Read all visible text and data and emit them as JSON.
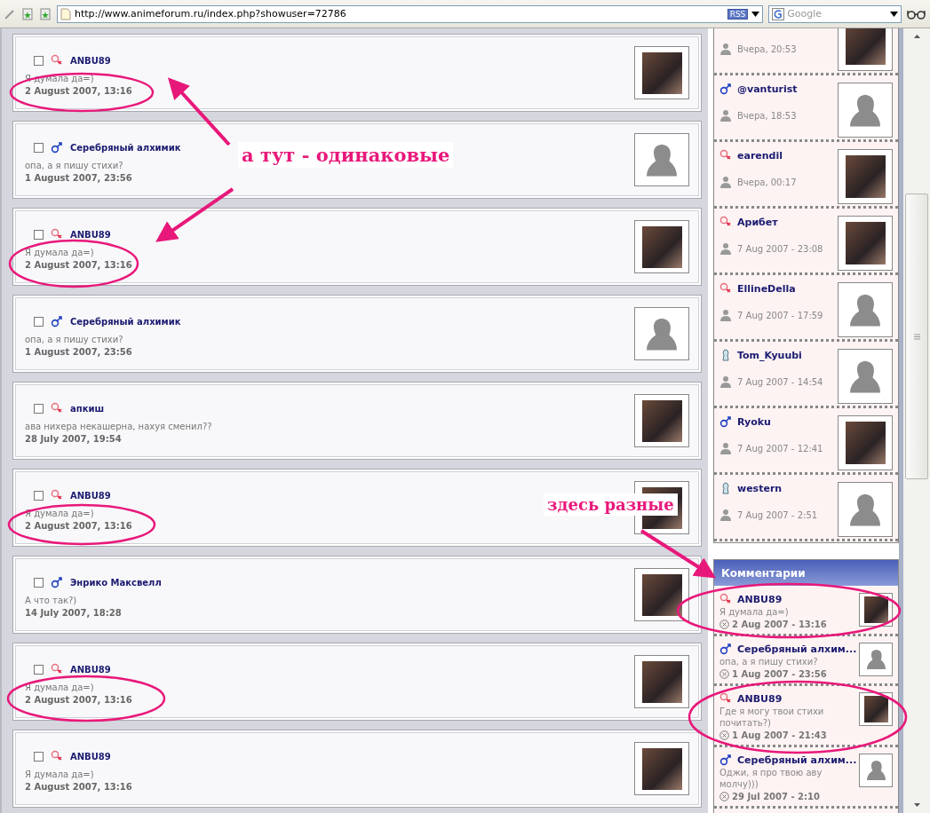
{
  "browser": {
    "url": "http://www.animeforum.ru/index.php?showuser=72786",
    "rss_badge": "RSS",
    "search": {
      "placeholder": "Google"
    }
  },
  "posts": [
    {
      "author": "ANBU89",
      "gender": {
        "kind": "female"
      },
      "text": "Я думала да=)",
      "date": "2 August 2007, 13:16",
      "avatar": {
        "kind": "photo"
      },
      "checked": false
    },
    {
      "author": "Серебряный алхимик",
      "gender": {
        "kind": "male"
      },
      "text": "опа, а я пишу стихи?",
      "date": "1 August 2007, 23:56",
      "avatar": {
        "kind": "default"
      },
      "checked": false
    },
    {
      "author": "ANBU89",
      "gender": {
        "kind": "female"
      },
      "text": "Я думала да=)",
      "date": "2 August 2007, 13:16",
      "avatar": {
        "kind": "photo"
      },
      "checked": false
    },
    {
      "author": "Серебряный алхимик",
      "gender": {
        "kind": "male"
      },
      "text": "опа, а я пишу стихи?",
      "date": "1 August 2007, 23:56",
      "avatar": {
        "kind": "default"
      },
      "checked": false
    },
    {
      "author": "апкиш",
      "gender": {
        "kind": "female"
      },
      "text": "ава нихера некашерна, нахуя сменил??",
      "date": "28 July 2007, 19:54",
      "avatar": {
        "kind": "photo"
      },
      "checked": false
    },
    {
      "author": "ANBU89",
      "gender": {
        "kind": "female"
      },
      "text": "Я думала да=)",
      "date": "2 August 2007, 13:16",
      "avatar": {
        "kind": "photo"
      },
      "checked": false
    },
    {
      "author": "Энрико Максвелл",
      "gender": {
        "kind": "male"
      },
      "text": "А что так?)",
      "date": "14 July 2007, 18:28",
      "avatar": {
        "kind": "photo"
      },
      "checked": false
    },
    {
      "author": "ANBU89",
      "gender": {
        "kind": "female"
      },
      "text": "Я думала да=)",
      "date": "2 August 2007, 13:16",
      "avatar": {
        "kind": "photo"
      },
      "checked": false
    },
    {
      "author": "ANBU89",
      "gender": {
        "kind": "female"
      },
      "text": "Я думала да=)",
      "date": "2 August 2007, 13:16",
      "avatar": {
        "kind": "photo"
      },
      "checked": false
    }
  ],
  "users": [
    {
      "time": "Вчера, 20:53",
      "avatar": {
        "kind": "photo"
      }
    },
    {
      "name": "@vanturist",
      "gender": {
        "kind": "male"
      },
      "time": "Вчера, 18:53",
      "avatar": {
        "kind": "default"
      }
    },
    {
      "name": "earendil",
      "gender": {
        "kind": "female"
      },
      "time": "Вчера, 00:17",
      "avatar": {
        "kind": "photo"
      }
    },
    {
      "name": "Арибет",
      "gender": {
        "kind": "female"
      },
      "time": "7 Aug 2007 - 23:08",
      "avatar": {
        "kind": "photo"
      }
    },
    {
      "name": "EllineDella",
      "gender": {
        "kind": "female"
      },
      "time": "7 Aug 2007 - 17:59",
      "avatar": {
        "kind": "default"
      }
    },
    {
      "name": "Tom_Kyuubi",
      "gender": {
        "kind": "unknown"
      },
      "time": "7 Aug 2007 - 14:54",
      "avatar": {
        "kind": "default"
      }
    },
    {
      "name": "Ryoku",
      "gender": {
        "kind": "male"
      },
      "time": "7 Aug 2007 - 12:41",
      "avatar": {
        "kind": "photo"
      }
    },
    {
      "name": "western",
      "gender": {
        "kind": "unknown"
      },
      "time": "7 Aug 2007 - 2:51",
      "avatar": {
        "kind": "default"
      }
    }
  ],
  "comments": {
    "title": "Комментарии",
    "items": [
      {
        "author": "ANBU89",
        "gender": {
          "kind": "female"
        },
        "text": "Я думала да=)",
        "date": "2 Aug 2007 - 13:16",
        "avatar": {
          "kind": "photo"
        }
      },
      {
        "author": "Серебряный алхим...",
        "gender": {
          "kind": "male"
        },
        "text": "опа, а я пишу стихи?",
        "date": "1 Aug 2007 - 23:56",
        "avatar": {
          "kind": "default"
        }
      },
      {
        "author": "ANBU89",
        "gender": {
          "kind": "female"
        },
        "text": "Где я могу твои стихи почитать?)",
        "date": "1 Aug 2007 - 21:43",
        "avatar": {
          "kind": "photo"
        }
      },
      {
        "author": "Серебряный алхим...",
        "gender": {
          "kind": "male"
        },
        "text": "Оджи, я про твою аву молчу)))",
        "date": "29 Jul 2007 - 2:10",
        "avatar": {
          "kind": "default"
        }
      }
    ]
  },
  "annotations": [
    {
      "text": "а тут - одинаковые"
    },
    {
      "text": "здесь разные"
    }
  ]
}
